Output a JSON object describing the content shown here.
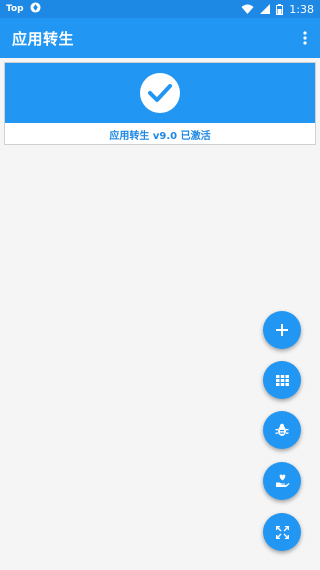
{
  "status_bar": {
    "left_label": "Top",
    "time": "1:38"
  },
  "app_bar": {
    "title": "应用转生",
    "overflow_icon": "more-vert-icon"
  },
  "activation": {
    "text": "应用转生 v9.0 已激活",
    "icon": "check-circle-icon"
  },
  "fabs": [
    {
      "name": "add-button",
      "icon": "plus-icon"
    },
    {
      "name": "apps-grid-button",
      "icon": "grid-icon"
    },
    {
      "name": "bug-button",
      "icon": "bug-icon"
    },
    {
      "name": "donate-button",
      "icon": "hand-heart-icon"
    },
    {
      "name": "fullscreen-button",
      "icon": "expand-icon"
    }
  ],
  "colors": {
    "primary": "#2196f3",
    "primary_dark": "#1e88e5",
    "background": "#f5f5f5"
  }
}
